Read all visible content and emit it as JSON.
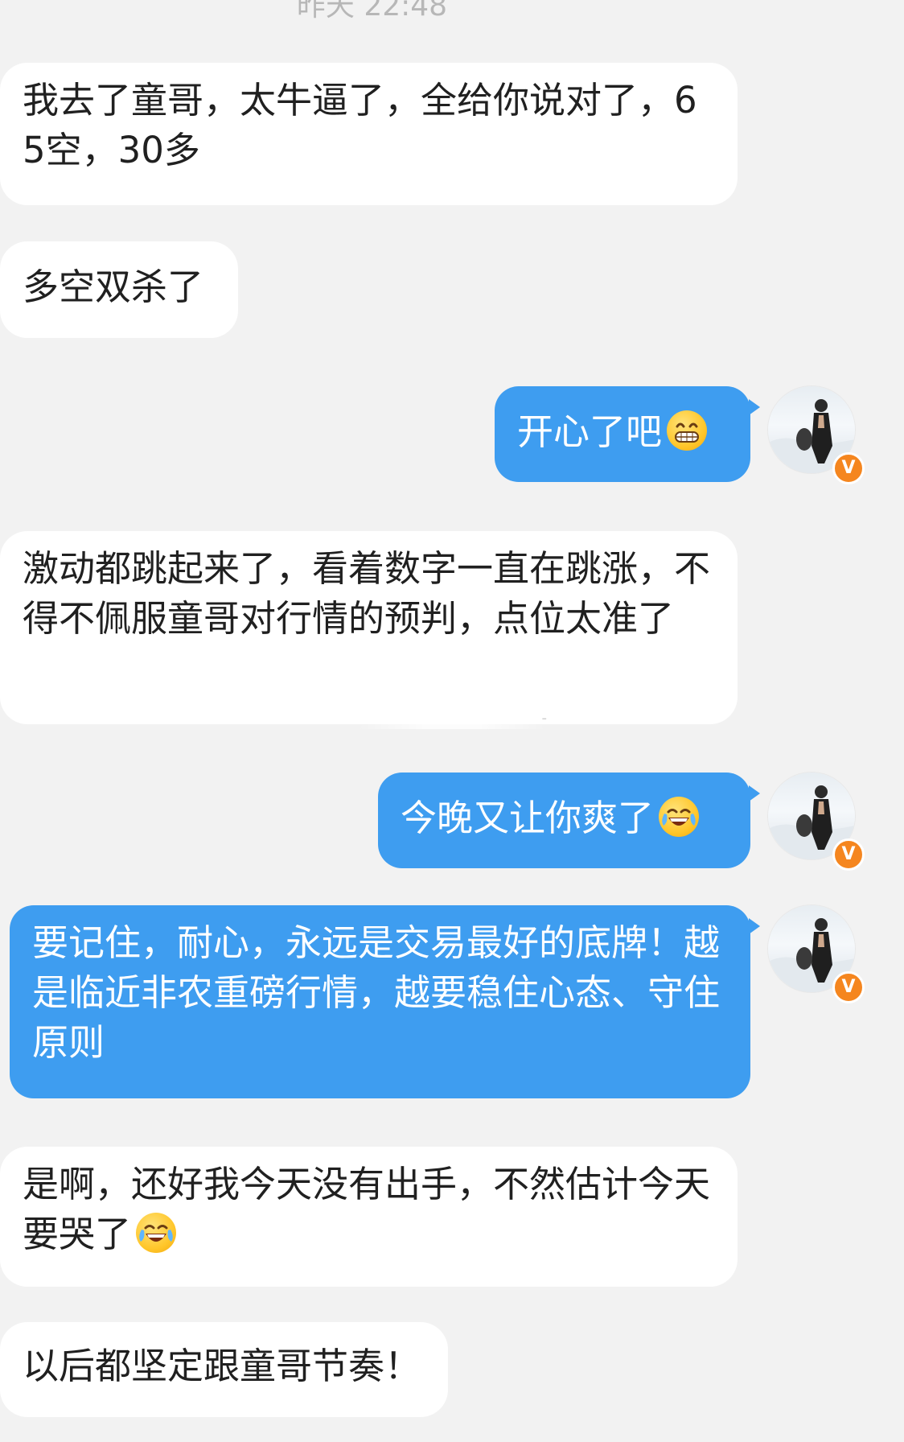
{
  "chat": {
    "timestamp": "昨天 22:48",
    "messages": [
      {
        "side": "left",
        "text": "我去了童哥，太牛逼了，全给你说对了，65空，30多"
      },
      {
        "side": "left",
        "text": "多空双杀了"
      },
      {
        "side": "right",
        "text": "开心了吧",
        "emoji": "grinning-face-icon"
      },
      {
        "side": "left",
        "text": "激动都跳起来了，看着数字一直在跳涨，不得不佩服童哥对行情的预判，点位太准了"
      },
      {
        "side": "right",
        "text": "今晚又让你爽了",
        "emoji": "tears-of-joy-icon"
      },
      {
        "side": "right",
        "text": "要记住，耐心，永远是交易最好的底牌！越是临近非农重磅行情，越要稳住心态、守住原则"
      },
      {
        "side": "left",
        "text": "是啊，还好我今天没有出手，不然估计今天要哭了",
        "emoji": "tears-of-joy-icon"
      },
      {
        "side": "left",
        "text": "以后都坚定跟童哥节奏！"
      }
    ],
    "avatar_badge": "V",
    "watermark": "-"
  },
  "colors": {
    "background": "#f2f2f2",
    "left_bubble": "#ffffff",
    "right_bubble": "#3e9df0",
    "verified_badge": "#f5861f"
  }
}
